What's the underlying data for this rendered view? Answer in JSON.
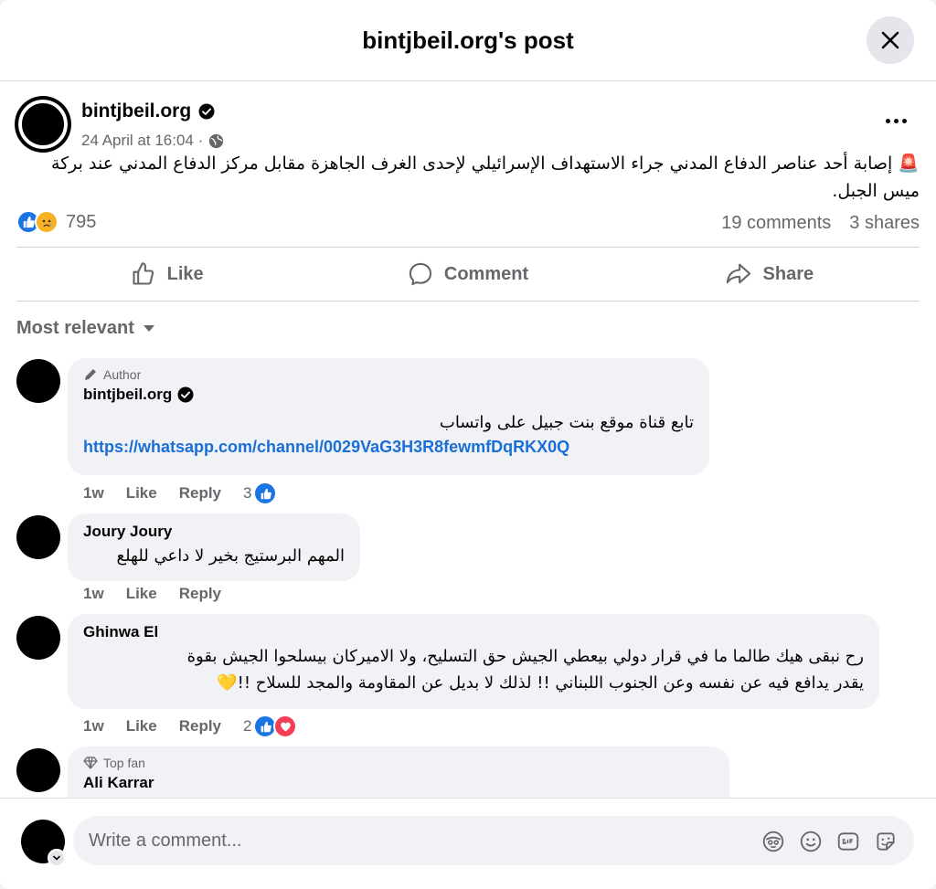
{
  "header": {
    "title": "bintjbeil.org's post"
  },
  "post": {
    "author": "bintjbeil.org",
    "timestamp": "24 April at 16:04 ·",
    "text": "🚨 إصابة أحد عناصر الدفاع المدني جراء الاستهداف الإسرائيلي لإحدى الغرف الجاهزة مقابل مركز الدفاع المدني عند بركة ميس الجبل.",
    "reaction_count": "795",
    "comments": "19 comments",
    "shares": "3 shares"
  },
  "actions": {
    "like": "Like",
    "comment": "Comment",
    "share": "Share"
  },
  "sort_label": "Most relevant",
  "comments": [
    {
      "badge": "Author",
      "name": "bintjbeil.org",
      "text": "تابع قناة موقع بنت جبيل على واتساب",
      "link": "https://whatsapp.com/channel/0029VaG3H3R8fewmfDqRKX0Q",
      "time": "1w",
      "like": "Like",
      "reply": "Reply",
      "reactions": "3"
    },
    {
      "name": "Joury Joury",
      "text": "المهم البرستيج بخير لا داعي للهلع",
      "time": "1w",
      "like": "Like",
      "reply": "Reply"
    },
    {
      "name": "Ghinwa El",
      "text_line1": "رح نبقى هيك طالما ما في قرار دولي بيعطي الجيش حق التسليح، ولا الاميركان بيسلحوا الجيش بقوة",
      "text_line2": "يقدر يدافع فيه عن نفسه وعن الجنوب اللبناني !! لذلك لا بديل عن المقاومة والمجد للسلاح !!💛",
      "time": "1w",
      "like": "Like",
      "reply": "Reply",
      "reactions": "2"
    },
    {
      "badge": "Top fan",
      "name": "Ali Karrar"
    }
  ],
  "composer": {
    "placeholder": "Write a comment..."
  },
  "colors": {
    "accent": "#1b74e4",
    "link": "#1a6ed8",
    "muted": "#65676b",
    "bubble": "#f0f2f5"
  }
}
